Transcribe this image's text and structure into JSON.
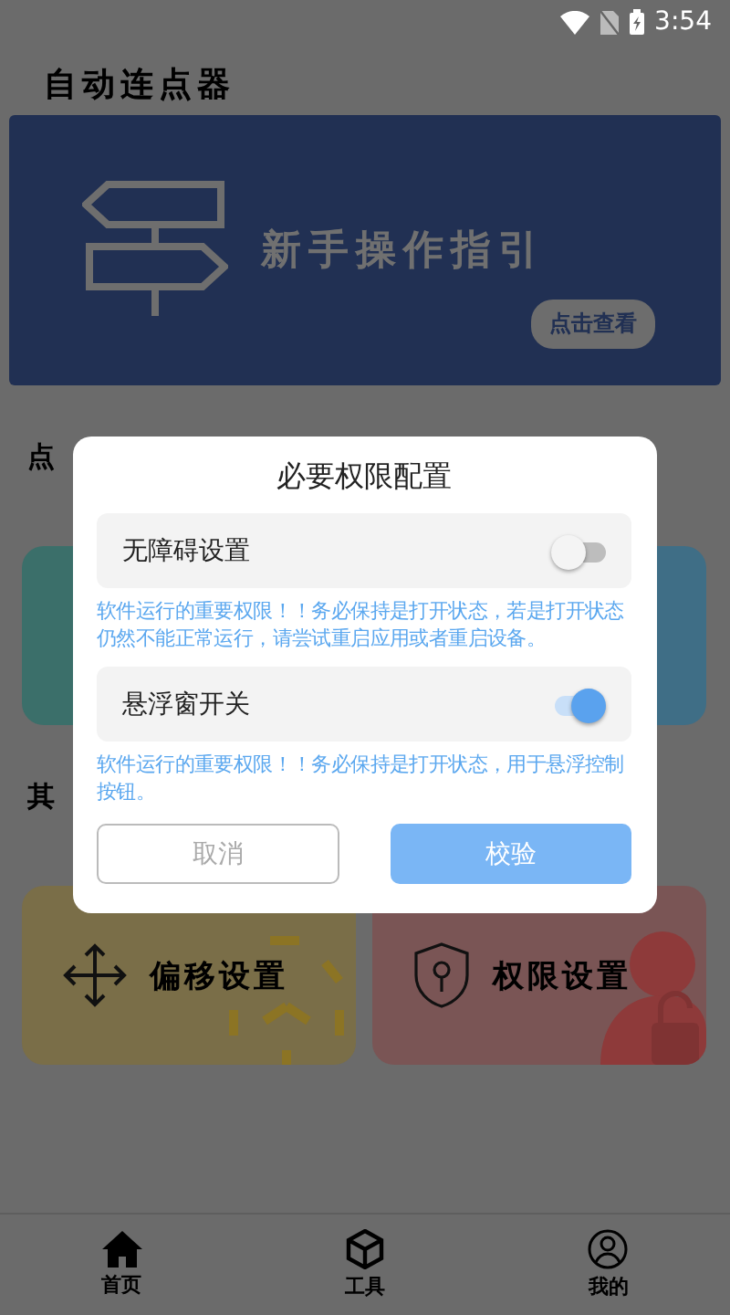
{
  "status_bar": {
    "time": "3:54"
  },
  "app_title": "自动连点器",
  "banner": {
    "title": "新手操作指引",
    "button": "点击查看"
  },
  "section_1": {
    "title": "点"
  },
  "top_cards": [
    {
      "color": "#3b6f6a"
    },
    {
      "color": "#3f6e86"
    }
  ],
  "section_2": {
    "title": "其"
  },
  "tool_cards": [
    {
      "label": "偏移设置",
      "kind": "offset",
      "color": "#7a6e48"
    },
    {
      "label": "权限设置",
      "kind": "permission",
      "color": "#7a5555"
    }
  ],
  "tab_bar": [
    {
      "label": "首页",
      "kind": "home"
    },
    {
      "label": "工具",
      "kind": "box"
    },
    {
      "label": "我的",
      "kind": "user"
    }
  ],
  "dialog": {
    "title": "必要权限配置",
    "settings": [
      {
        "label": "无障碍设置",
        "on": false,
        "hint": "软件运行的重要权限！！务必保持是打开状态，若是打开状态仍然不能正常运行，请尝试重启应用或者重启设备。"
      },
      {
        "label": "悬浮窗开关",
        "on": true,
        "hint": "软件运行的重要权限！！务必保持是打开状态，用于悬浮控制按钮。"
      }
    ],
    "cancel": "取消",
    "confirm": "校验"
  }
}
